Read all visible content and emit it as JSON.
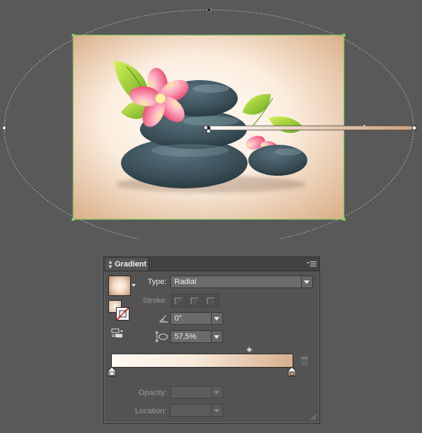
{
  "panel": {
    "title": "Gradient",
    "type_label": "Type:",
    "type_value": "Radial",
    "stroke_label": "Stroke:",
    "angle_value": "0°",
    "aspect_value": "57,5%",
    "opacity_label": "Opacity:",
    "location_label": "Location:",
    "opacity_value": "",
    "location_value": ""
  },
  "gradient": {
    "start_color": "#fff8ee",
    "end_color": "#d4aa86",
    "stops": [
      "#ffffff",
      "#c79a74"
    ]
  },
  "icons": {
    "tab_arrows": "double-triangle-icon",
    "menu": "panel-menu-icon",
    "angle": "angle-icon",
    "aspect": "aspect-ratio-icon",
    "trash": "trash-icon",
    "swap": "reverse-gradient-icon"
  }
}
